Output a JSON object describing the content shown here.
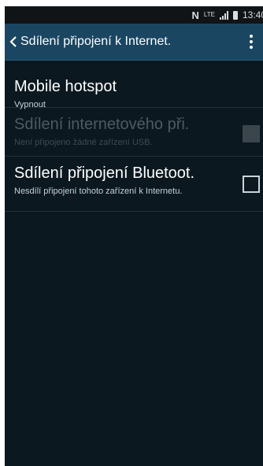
{
  "status_bar": {
    "nfc": "N",
    "network": "LTE",
    "time": "13:40"
  },
  "action_bar": {
    "title": "Sdílení připojení k Internet."
  },
  "settings": [
    {
      "title": "Mobile hotspot",
      "subtitle": "Vypnout",
      "enabled": true
    },
    {
      "title": "Sdílení internetového při.",
      "subtitle": "Není připojeno žádné zařízení USB.",
      "enabled": false,
      "checked": false
    },
    {
      "title": "Sdílení připojení Bluetoot.",
      "subtitle": "Nesdílí připojení tohoto zařízení k Internetu.",
      "enabled": true,
      "checked": false
    }
  ],
  "colors": {
    "action_bar": "#1b4662",
    "background": "#0b1820",
    "status_bar": "#101417"
  }
}
